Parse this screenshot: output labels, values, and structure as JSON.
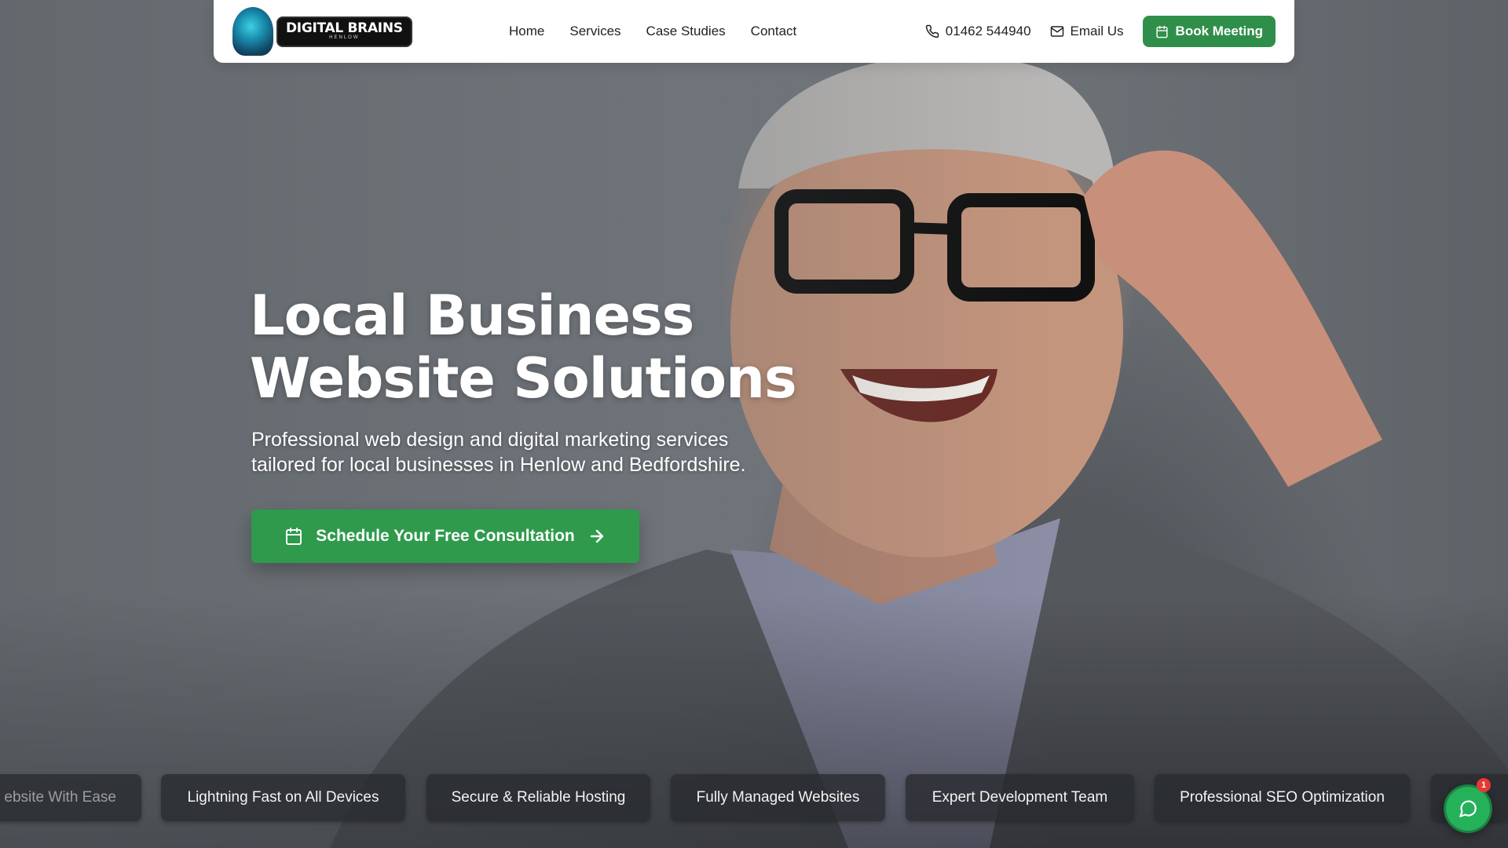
{
  "header": {
    "logo": {
      "title": "DIGITAL BRAINS",
      "subtitle": "HENLOW"
    },
    "nav": [
      "Home",
      "Services",
      "Case Studies",
      "Contact"
    ],
    "phone": "01462 544940",
    "email_label": "Email Us",
    "book_label": "Book Meeting"
  },
  "hero": {
    "title_line1": "Local Business",
    "title_line2": "Website Solutions",
    "subtitle_line1": "Professional web design and digital marketing services",
    "subtitle_line2": "tailored for local businesses in Henlow and Bedfordshire.",
    "cta_label": "Schedule Your Free Consultation"
  },
  "ticker": [
    "ebsite With Ease",
    "Lightning Fast on All Devices",
    "Secure & Reliable Hosting",
    "Fully Managed Websites",
    "Expert Development Team",
    "Professional SEO Optimization"
  ],
  "chat": {
    "badge_count": "1"
  },
  "colors": {
    "brand_green": "#2f9a4c",
    "header_bg": "#ffffff"
  },
  "icons": [
    "phone-icon",
    "mail-icon",
    "calendar-icon",
    "arrow-right-icon",
    "chat-icon"
  ]
}
